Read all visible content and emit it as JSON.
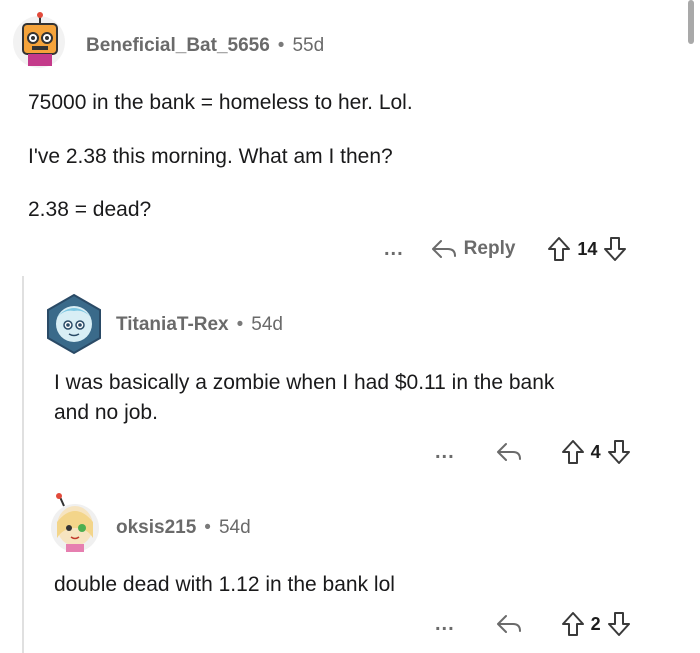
{
  "comments": [
    {
      "author": "Beneficial_Bat_5656",
      "age": "55d",
      "lines": [
        "75000 in the bank = homeless to her. Lol.",
        "I've 2.38 this morning. What am I then?",
        "2.38 = dead?"
      ],
      "more": "...",
      "reply_label": "Reply",
      "votes": "14",
      "avatar_icon": "robot-avatar-icon"
    },
    {
      "author": "TitaniaT-Rex",
      "age": "54d",
      "lines": [
        "I was basically a zombie when I had $0.11 in the bank",
        "and no job."
      ],
      "more": "...",
      "votes": "4",
      "avatar_icon": "hexagon-avatar-icon"
    },
    {
      "author": "oksis215",
      "age": "54d",
      "lines": [
        "double dead with 1.12 in the bank lol"
      ],
      "more": "...",
      "votes": "2",
      "avatar_icon": "girl-avatar-icon"
    }
  ],
  "separator": "•",
  "colors": {
    "avatar1_bg": "#f5a33a",
    "avatar2_bg": "#3a6a8a",
    "avatar3_bg": "#f6e4c0"
  }
}
